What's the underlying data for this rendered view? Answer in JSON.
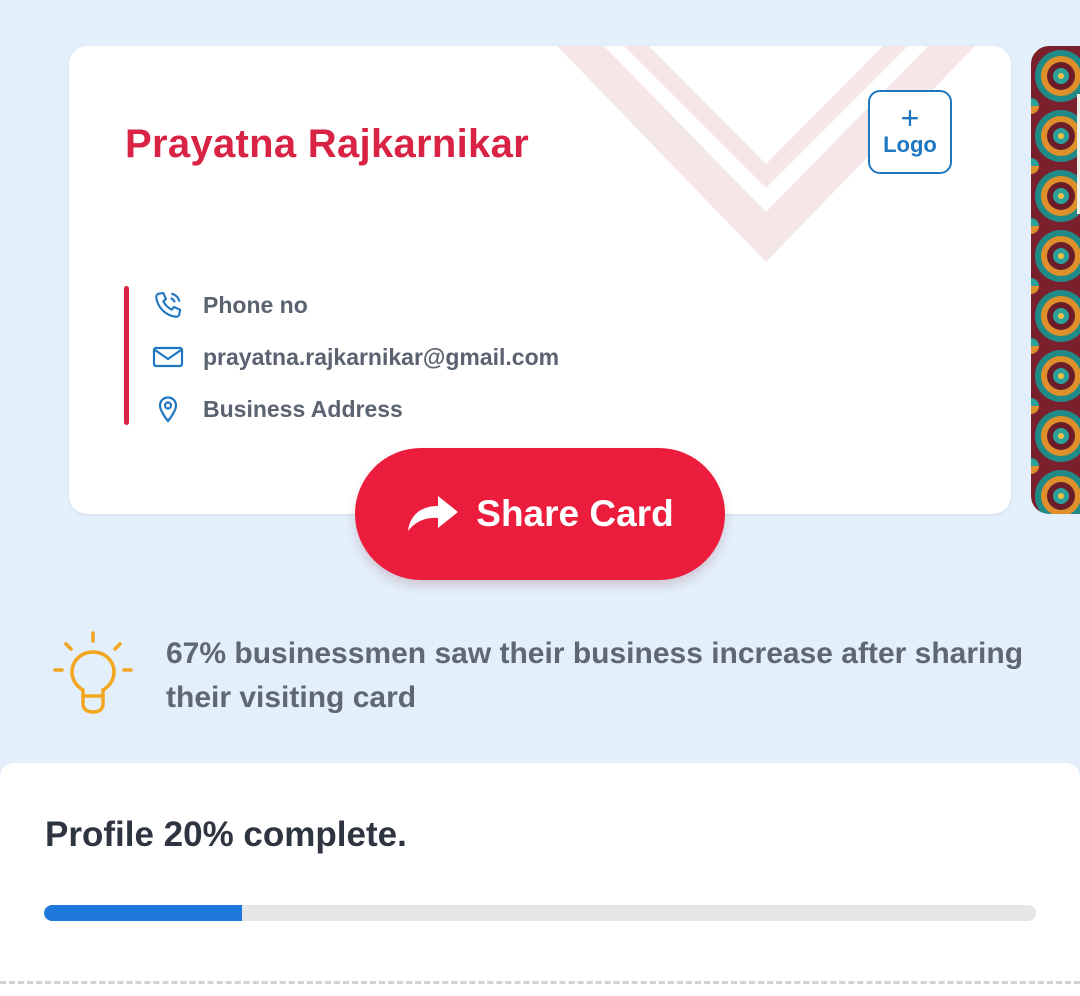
{
  "card": {
    "name": "Prayatna Rajkarnikar",
    "logo_button": {
      "plus": "+",
      "label": "Logo"
    },
    "contacts": [
      {
        "icon": "phone-icon",
        "text": "Phone no"
      },
      {
        "icon": "mail-icon",
        "text": "prayatna.rajkarnikar@gmail.com"
      },
      {
        "icon": "location-pin-icon",
        "text": "Business Address"
      }
    ]
  },
  "share_button": {
    "label": "Share Card",
    "icon": "share-arrow-icon"
  },
  "tip": {
    "icon": "lightbulb-icon",
    "text": "67% businessmen saw their business increase after sharing their visiting card"
  },
  "profile": {
    "status_text": "Profile 20% complete.",
    "progress": 0.2
  },
  "colors": {
    "background": "#e3effb",
    "accent_red": "#d92345",
    "share_red": "#ec1c3c",
    "blue": "#1f77c1",
    "progress_blue": "#1e78dc",
    "bulb_orange": "#f2a51f"
  }
}
